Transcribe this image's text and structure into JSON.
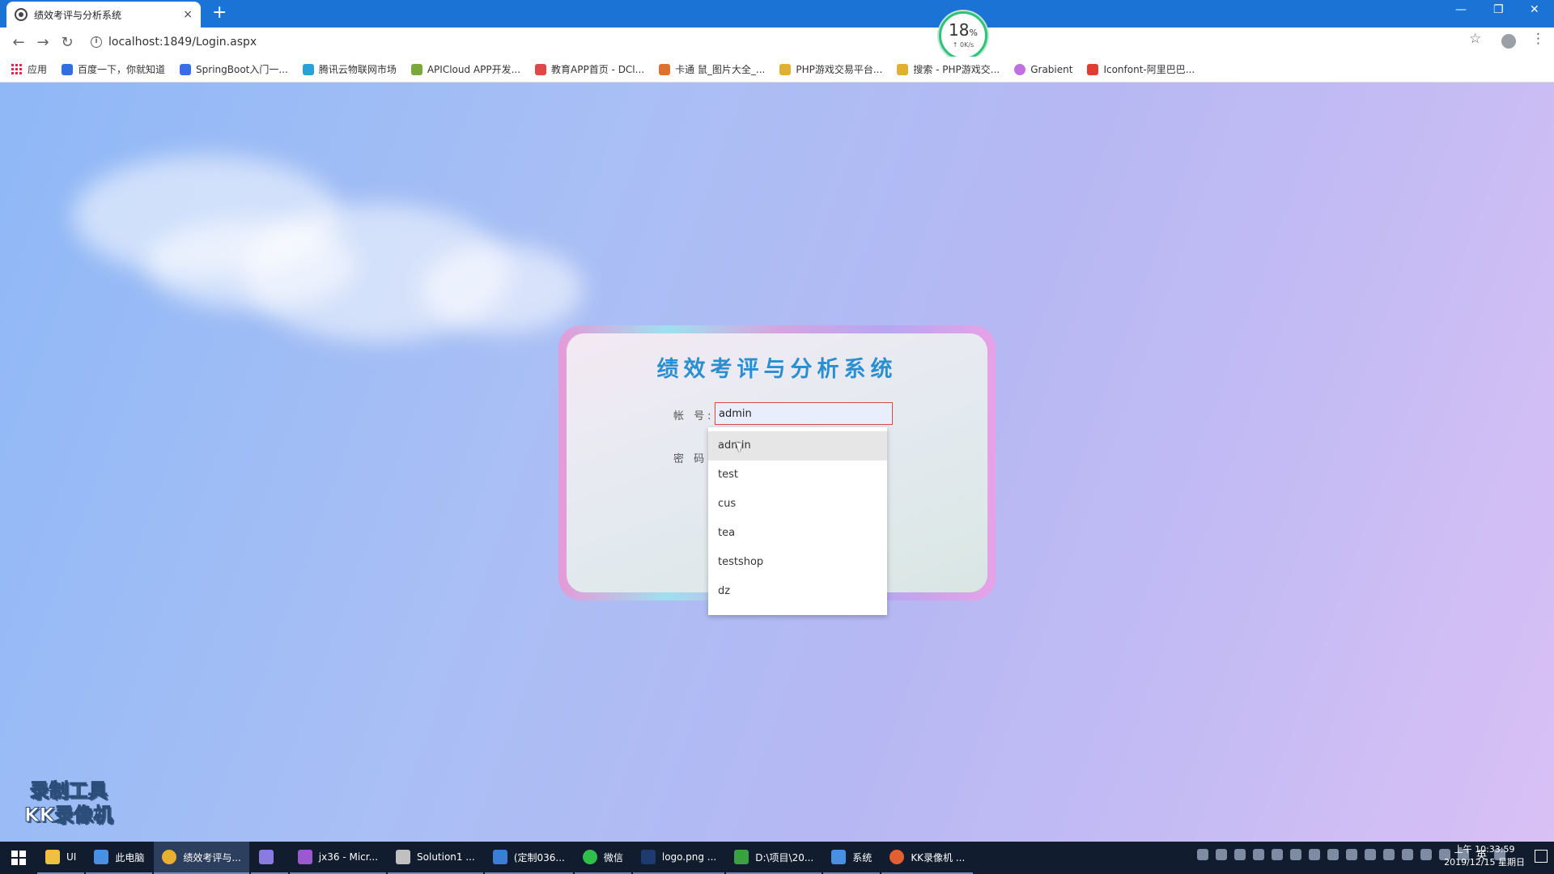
{
  "browser": {
    "tab_title": "绩效考评与分析系统",
    "tab_close": "×",
    "new_tab": "+",
    "url": "localhost:1849/Login.aspx",
    "win_minimize": "—",
    "win_restore": "❐",
    "win_close": "✕"
  },
  "speed_widget": {
    "percent": "18",
    "percent_unit": "%",
    "rate": "↑ 0K/s"
  },
  "bookmarks": [
    {
      "label": "应用",
      "color": "#e03c31"
    },
    {
      "label": "百度一下，你就知道",
      "color": "#2f6fe0"
    },
    {
      "label": "SpringBoot入门一...",
      "color": "#3a6ee8"
    },
    {
      "label": "腾讯云物联网市场",
      "color": "#2aa0d8"
    },
    {
      "label": "APICloud APP开发...",
      "color": "#7aa83b"
    },
    {
      "label": "教育APP首页 - DCl...",
      "color": "#e04848"
    },
    {
      "label": "卡通 鼠_图片大全_...",
      "color": "#e07030"
    },
    {
      "label": "PHP游戏交易平台...",
      "color": "#e0b030"
    },
    {
      "label": "搜索 - PHP游戏交...",
      "color": "#e0b030"
    },
    {
      "label": "Grabient",
      "color": "#c070e0"
    },
    {
      "label": "Iconfont-阿里巴巴...",
      "color": "#e03c31"
    }
  ],
  "login": {
    "title": "绩效考评与分析系统",
    "account_label": "帐 号:",
    "account_value": "admin",
    "password_label": "密 码:"
  },
  "autocomplete": {
    "options": [
      "admin",
      "test",
      "cus",
      "tea",
      "testshop",
      "dz"
    ]
  },
  "watermark": {
    "line1": "录制工具",
    "line2": "KK录像机"
  },
  "taskbar": {
    "items": [
      {
        "label": "UI",
        "color": "#f0c040",
        "active": false
      },
      {
        "label": "此电脑",
        "color": "#4a90e2",
        "active": false
      },
      {
        "label": "绩效考评与...",
        "color": "#e8b030",
        "active": true
      },
      {
        "label": "",
        "color": "#8a7be0",
        "active": false
      },
      {
        "label": "jx36 - Micr...",
        "color": "#9b59d0",
        "active": false
      },
      {
        "label": "Solution1 ...",
        "color": "#c0c0c0",
        "active": false
      },
      {
        "label": "(定制036...",
        "color": "#3a7ed8",
        "active": false
      },
      {
        "label": "微信",
        "color": "#2fbf4a",
        "active": false
      },
      {
        "label": "logo.png ...",
        "color": "#1e3a6e",
        "active": false
      },
      {
        "label": "D:\\项目\\20...",
        "color": "#3aa040",
        "active": false
      },
      {
        "label": "系统",
        "color": "#4a90e2",
        "active": false
      },
      {
        "label": "KK录像机 ...",
        "color": "#e06030",
        "active": false
      }
    ],
    "ime": "英",
    "time": "上午 10:33:59",
    "date": "2019/12/15 星期日"
  }
}
